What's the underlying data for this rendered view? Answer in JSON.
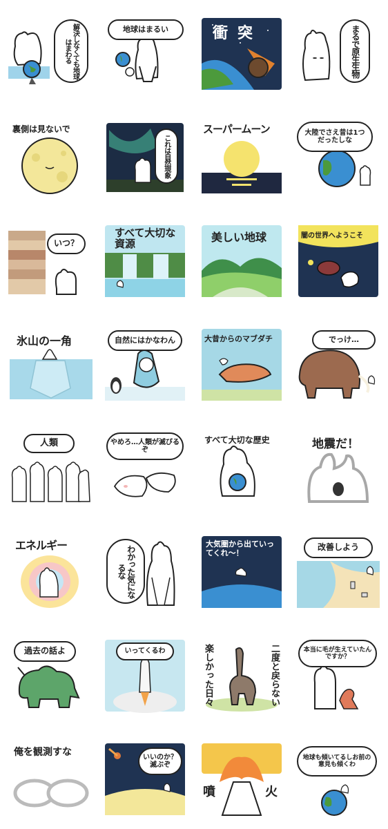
{
  "title": "",
  "stickers": [
    {
      "id": 1,
      "text": "解決しなくても地球はまわる",
      "icon": "rabbit-globe"
    },
    {
      "id": 2,
      "text": "地球はまるい",
      "icon": "rabbit-suit-globe"
    },
    {
      "id": 3,
      "text": "衝突",
      "icon": "meteor-earth"
    },
    {
      "id": 4,
      "text": "まるで原生生物",
      "icon": "rabbit"
    },
    {
      "id": 5,
      "text": "裏側は見ないで",
      "icon": "moon"
    },
    {
      "id": 6,
      "text": "これは自然現象",
      "icon": "aurora-rabbit"
    },
    {
      "id": 7,
      "text": "スーパームーン",
      "icon": "supermoon"
    },
    {
      "id": 8,
      "text": "大陸でさえ昔は1つだったしな",
      "icon": "earth-rabbit"
    },
    {
      "id": 9,
      "text": "いつ？",
      "icon": "strata-rabbit"
    },
    {
      "id": 10,
      "text": "すべて大切な資源",
      "icon": "waterfall"
    },
    {
      "id": 11,
      "text": "美しい地球",
      "icon": "mountains"
    },
    {
      "id": 12,
      "text": "闇の世界へようこそ",
      "icon": "deep-sea-fish"
    },
    {
      "id": 13,
      "text": "氷山の一角",
      "icon": "iceberg"
    },
    {
      "id": 14,
      "text": "自然にはかなわん",
      "icon": "snow-rabbit-penguin"
    },
    {
      "id": 15,
      "text": "大昔からのマブダチ",
      "icon": "anomalocaris"
    },
    {
      "id": 16,
      "text": "でっけ…",
      "icon": "mammoth"
    },
    {
      "id": 17,
      "text": "人類",
      "icon": "rabbit-crowd"
    },
    {
      "id": 18,
      "text": "やめろ…人類が滅びるぞ",
      "icon": "rabbits-lying"
    },
    {
      "id": 19,
      "text": "すべて大切な歴史",
      "icon": "rabbit-hug-earth"
    },
    {
      "id": 20,
      "text": "地震だ！",
      "icon": "shaking-rabbit"
    },
    {
      "id": 21,
      "text": "エネルギー",
      "icon": "glowing-rabbit"
    },
    {
      "id": 22,
      "text": "わかった気になるな",
      "icon": "rabbit-suit"
    },
    {
      "id": 23,
      "text": "大気圏から出ていってくれ〜！",
      "icon": "space-rabbit"
    },
    {
      "id": 24,
      "text": "改善しよう",
      "icon": "beach-trash"
    },
    {
      "id": 25,
      "text": "過去の話よ",
      "icon": "triceratops"
    },
    {
      "id": 26,
      "text": "いってくるわ",
      "icon": "rocket"
    },
    {
      "id": 27,
      "text": [
        "楽しかった日々",
        "二度と戻らない"
      ],
      "icon": "dinosaur"
    },
    {
      "id": 28,
      "text": "本当に毛が生えていたんですか？",
      "icon": "rabbit-trex"
    },
    {
      "id": 29,
      "text": "俺を観測すな",
      "icon": "blurry-rabbits"
    },
    {
      "id": 30,
      "text": "いいのか？滅ぶぞ",
      "icon": "moon-meteor"
    },
    {
      "id": 31,
      "text": [
        "噴",
        "火"
      ],
      "icon": "volcano"
    },
    {
      "id": 32,
      "text": "地球も傾いてるしお前の意見も傾くわ",
      "icon": "tilted-earth"
    }
  ],
  "colors": {
    "ink": "#222222",
    "sky": "#a6d8e6",
    "space": "#1f3352",
    "earth_blue": "#3a8fd1",
    "earth_green": "#4c9a3c",
    "moon": "#f3e79a",
    "sand": "#f4e3b8"
  }
}
